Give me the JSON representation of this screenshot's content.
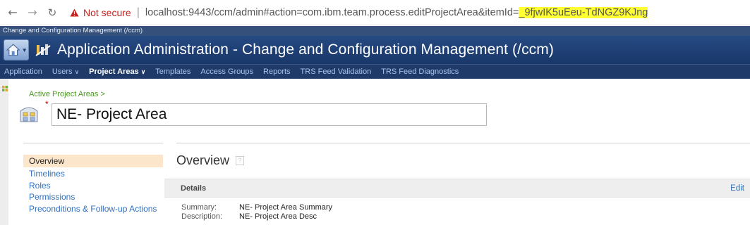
{
  "browser": {
    "back_icon": "back-arrow-icon",
    "forward_icon": "forward-arrow-icon",
    "reload_icon": "reload-icon",
    "security_label": "Not secure",
    "separator": "|",
    "url_main": "localhost:9443/ccm/admin#action=com.ibm.team.process.editProjectArea&itemId=",
    "url_highlighted": "_9fjwIK5uEeu-TdNGZ9KJng"
  },
  "app": {
    "context_label": "Change and Configuration Management (/ccm)",
    "title": "Application Administration - Change and Configuration Management (/ccm)"
  },
  "menu": {
    "items": [
      {
        "label": "Application",
        "dropdown": false,
        "active": false
      },
      {
        "label": "Users",
        "dropdown": true,
        "active": false
      },
      {
        "label": "Project Areas",
        "dropdown": true,
        "active": true
      },
      {
        "label": "Templates",
        "dropdown": false,
        "active": false
      },
      {
        "label": "Access Groups",
        "dropdown": false,
        "active": false
      },
      {
        "label": "Reports",
        "dropdown": false,
        "active": false
      },
      {
        "label": "TRS Feed Validation",
        "dropdown": false,
        "active": false
      },
      {
        "label": "TRS Feed Diagnostics",
        "dropdown": false,
        "active": false
      }
    ],
    "dropdown_arrow": "∨"
  },
  "page": {
    "breadcrumb": "Active Project Areas >",
    "required_mark": "*",
    "project_name": "NE- Project Area"
  },
  "sidebar": {
    "items": [
      {
        "label": "Overview",
        "selected": true
      },
      {
        "label": "Timelines",
        "selected": false
      },
      {
        "label": "Roles",
        "selected": false
      },
      {
        "label": "Permissions",
        "selected": false
      },
      {
        "label": "Preconditions & Follow-up Actions",
        "selected": false
      }
    ]
  },
  "main": {
    "section_title": "Overview",
    "help_glyph": "?",
    "details_title": "Details",
    "edit_label": "Edit",
    "summary_key": "Summary:",
    "summary_value": "NE- Project Area Summary",
    "description_key": "Description:",
    "description_value": "NE- Project Area Desc"
  },
  "colors": {
    "title_bar": "#1f3a68",
    "not_secure": "#c5221f",
    "url_highlight": "#ffff33",
    "link": "#3070bd",
    "selected_nav_bg": "#fbe6cb",
    "breadcrumb": "#4a9a1f"
  }
}
